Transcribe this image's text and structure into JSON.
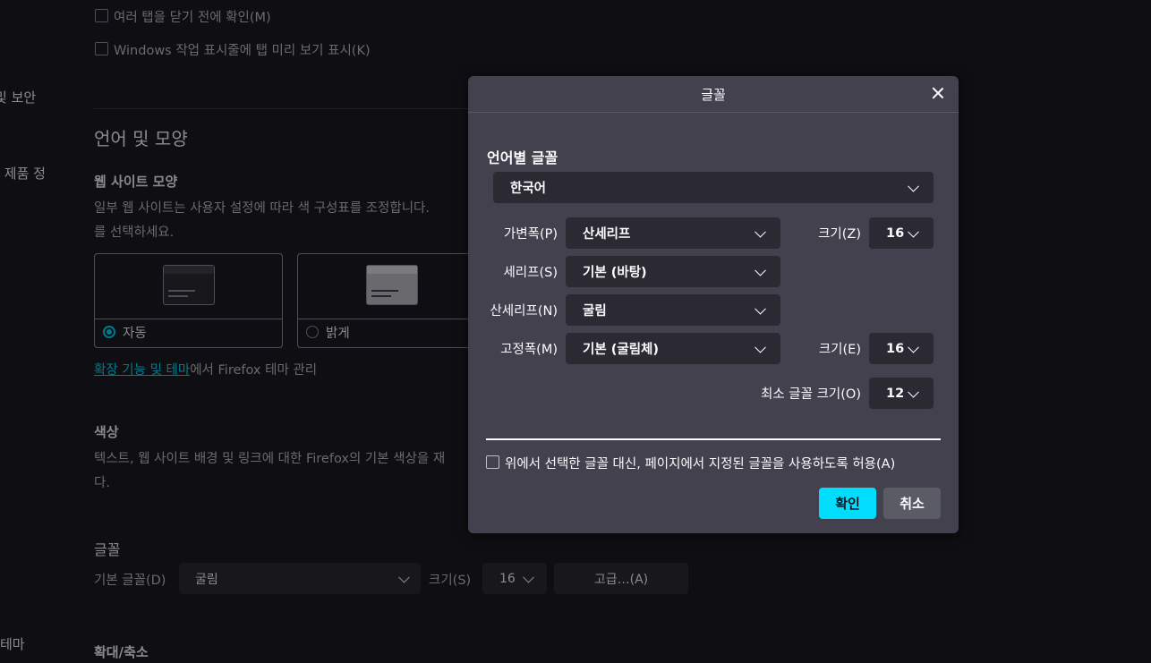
{
  "background": {
    "tabs_confirm_label": "여러 탭을 닫기 전에 확인(M)",
    "taskbar_preview_label": "Windows 작업 표시줄에 탭 미리 보기 표시(K)",
    "sidebar": {
      "item_privacy": "및 보안",
      "item_products": "› 제품 정",
      "item_themes": "테마"
    },
    "lang_section_title": "언어 및 모양",
    "website_appearance": {
      "title": "웹 사이트 모양",
      "desc_line1": "일부 웹 사이트는 사용자 설정에 따라 색 구성표를 조정합니다.",
      "desc_line2": "를 선택하세요.",
      "option_auto": "자동",
      "option_light": "밝게",
      "themes_link": "확장 기능 및 테마",
      "themes_suffix": "에서 Firefox 테마 관리"
    },
    "colors": {
      "title": "색상",
      "desc_line1": "텍스트, 웹 사이트 배경 및 링크에 대한 Firefox의 기본 색상을 재",
      "desc_line2": "다."
    },
    "fonts": {
      "title": "글꼴",
      "default_font_label": "기본 글꼴(D)",
      "default_font_value": "굴림",
      "size_label": "크기(S)",
      "size_value": "16",
      "advanced_button": "고급…(A)"
    },
    "zoom_title": "확대/축소"
  },
  "dialog": {
    "title": "글꼴",
    "section_label": "언어별 글꼴",
    "language_value": "한국어",
    "proportional_label": "가변폭(P)",
    "proportional_value": "산세리프",
    "proportional_size_label": "크기(Z)",
    "proportional_size_value": "16",
    "serif_label": "세리프(S)",
    "serif_value": "기본 (바탕)",
    "sans_label": "산세리프(N)",
    "sans_value": "굴림",
    "mono_label": "고정폭(M)",
    "mono_value": "기본 (굴림체)",
    "mono_size_label": "크기(E)",
    "mono_size_value": "16",
    "min_size_label": "최소 글꼴 크기(O)",
    "min_size_value": "12",
    "allow_pages_label": "위에서 선택한 글꼴 대신, 페이지에서 지정된 글꼴을 사용하도록 허용(A)",
    "ok_button": "확인",
    "cancel_button": "취소"
  },
  "colors": {
    "accent": "#00ddff",
    "background": "#1c1b22",
    "dialog_bg": "#42414d",
    "field_bg": "#2b2a33"
  },
  "icons": [
    "close-icon",
    "chevron-down-icon",
    "checkbox-icon",
    "radio-icon"
  ]
}
